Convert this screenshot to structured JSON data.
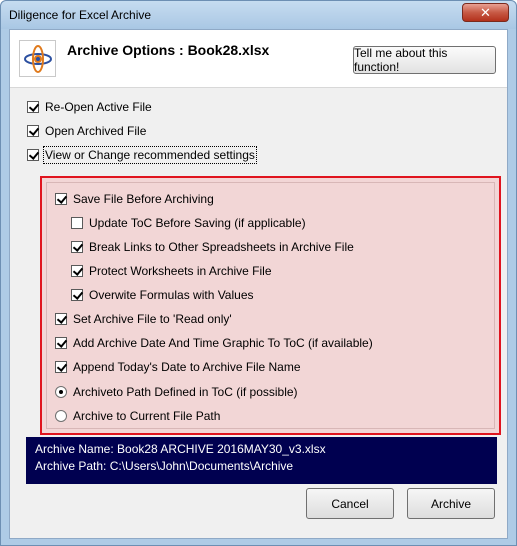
{
  "window": {
    "title": "Diligence for Excel Archive",
    "close_symbol": "✕"
  },
  "header": {
    "title": "Archive Options : Book28.xlsx",
    "help_button": "Tell me about this function!",
    "logo_icon": "diligence-logo-icon"
  },
  "options": [
    {
      "label": "Re-Open Active File",
      "checked": true
    },
    {
      "label": "Open Archived File",
      "checked": true
    },
    {
      "label": "View or Change recommended settings",
      "checked": true
    }
  ],
  "settings": {
    "save_before": {
      "label": "Save File Before Archiving",
      "checked": true
    },
    "sub_options": [
      {
        "label": "Update ToC Before Saving (if applicable)",
        "checked": false
      },
      {
        "label": "Break Links to Other Spreadsheets in Archive File",
        "checked": true
      },
      {
        "label": "Protect  Worksheets in Archive File",
        "checked": true
      },
      {
        "label": "Overwite Formulas with Values",
        "checked": true
      }
    ],
    "more_options": [
      {
        "label": "Set Archive File to 'Read only'",
        "checked": true
      },
      {
        "label": "Add Archive Date And Time Graphic To ToC (if available)",
        "checked": true
      },
      {
        "label": "Append Today's Date to Archive File Name",
        "checked": true
      }
    ],
    "radios": [
      {
        "label": "Archiveto Path Defined in ToC (if possible)",
        "selected": true
      },
      {
        "label": "Archive to Current File Path",
        "selected": false
      }
    ]
  },
  "info": {
    "archive_name": "Archive Name: Book28 ARCHIVE 2016MAY30_v3.xlsx",
    "archive_path": "Archive Path: C:\\Users\\John\\Documents\\Archive"
  },
  "buttons": {
    "cancel": "Cancel",
    "archive": "Archive"
  },
  "colors": {
    "settings_background": "#f2d6d6",
    "settings_border": "#e0141e",
    "info_background": "#000050"
  }
}
